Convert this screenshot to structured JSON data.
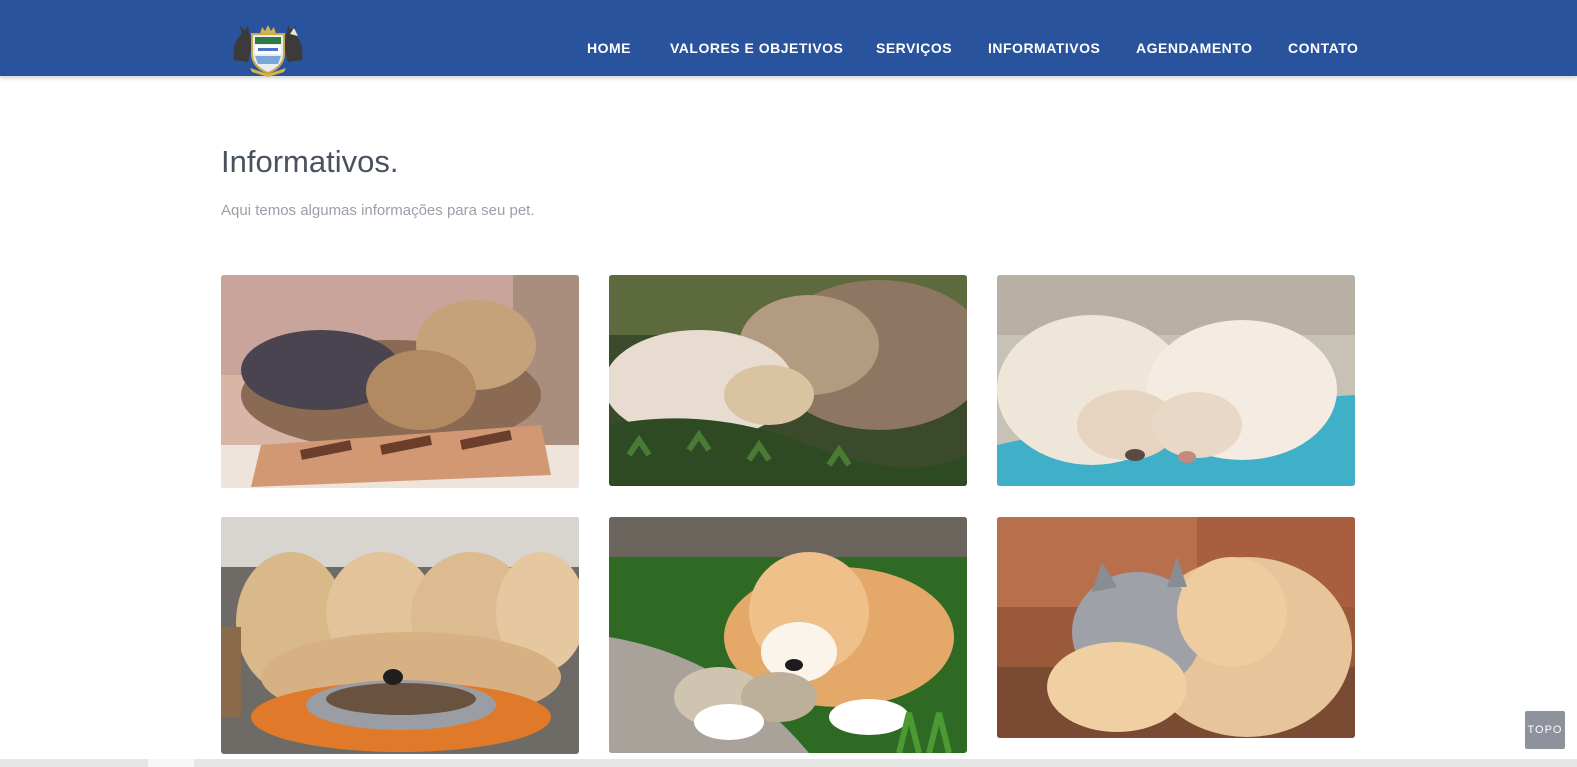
{
  "header": {
    "background_color": "#2a539e",
    "logo": "pet-crest-logo",
    "nav": [
      {
        "label": "HOME"
      },
      {
        "label": "VALORES E OBJETIVOS"
      },
      {
        "label": "SERVIÇOS"
      },
      {
        "label": "INFORMATIVOS"
      },
      {
        "label": "AGENDAMENTO"
      },
      {
        "label": "CONTATO"
      }
    ]
  },
  "main": {
    "title": "Informativos.",
    "subtitle": "Aqui temos algumas informações para seu pet.",
    "gallery": [
      {
        "image": "yorkshire-terrier-sleeping-photo"
      },
      {
        "image": "cat-and-dog-cuddling-on-grass-photo"
      },
      {
        "image": "white-puppies-sleeping-on-blue-blanket-photo"
      },
      {
        "image": "golden-retriever-puppies-eating-photo"
      },
      {
        "image": "akita-puppy-chewing-on-grass-photo"
      },
      {
        "image": "kittens-hugging-photo"
      }
    ]
  },
  "topo_button": {
    "label": "TOPO"
  }
}
